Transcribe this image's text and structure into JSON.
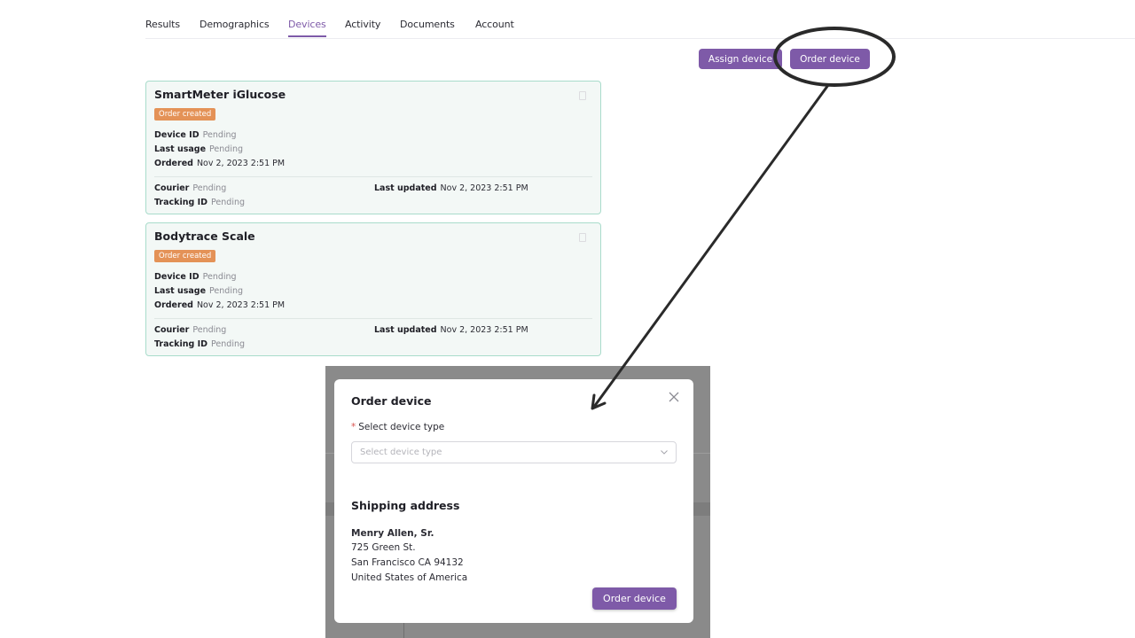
{
  "tabs": [
    {
      "label": "Results"
    },
    {
      "label": "Demographics"
    },
    {
      "label": "Devices",
      "active": true
    },
    {
      "label": "Activity"
    },
    {
      "label": "Documents"
    },
    {
      "label": "Account"
    }
  ],
  "toolbar": {
    "assign_label": "Assign device",
    "order_label": "Order device"
  },
  "devices": [
    {
      "name": "SmartMeter iGlucose",
      "status": "Order created",
      "device_id_label": "Device ID",
      "device_id": "Pending",
      "last_usage_label": "Last usage",
      "last_usage": "Pending",
      "ordered_label": "Ordered",
      "ordered": "Nov 2, 2023 2:51 PM",
      "courier_label": "Courier",
      "courier": "Pending",
      "tracking_label": "Tracking ID",
      "tracking": "Pending",
      "last_updated_label": "Last updated",
      "last_updated": "Nov 2, 2023 2:51 PM"
    },
    {
      "name": "Bodytrace Scale",
      "status": "Order created",
      "device_id_label": "Device ID",
      "device_id": "Pending",
      "last_usage_label": "Last usage",
      "last_usage": "Pending",
      "ordered_label": "Ordered",
      "ordered": "Nov 2, 2023 2:51 PM",
      "courier_label": "Courier",
      "courier": "Pending",
      "tracking_label": "Tracking ID",
      "tracking": "Pending",
      "last_updated_label": "Last updated",
      "last_updated": "Nov 2, 2023 2:51 PM"
    }
  ],
  "modal": {
    "title": "Order device",
    "required_mark": "*",
    "select_label": "Select device type",
    "select_placeholder": "Select device type",
    "shipping_title": "Shipping address",
    "address": {
      "name": "Menry Allen, Sr.",
      "line1": "725 Green St.",
      "line2": "San Francisco CA 94132",
      "line3": "United States of America"
    },
    "submit_label": "Order device"
  },
  "colors": {
    "accent": "#7e5aa8",
    "badge": "#e49257",
    "card_border": "#a9dccb",
    "card_bg": "#f3f8f6",
    "annotation": "#2a2a2a"
  },
  "icons": {
    "close": "close-icon",
    "chevron": "chevron-down-icon",
    "trash": "trash-icon"
  }
}
